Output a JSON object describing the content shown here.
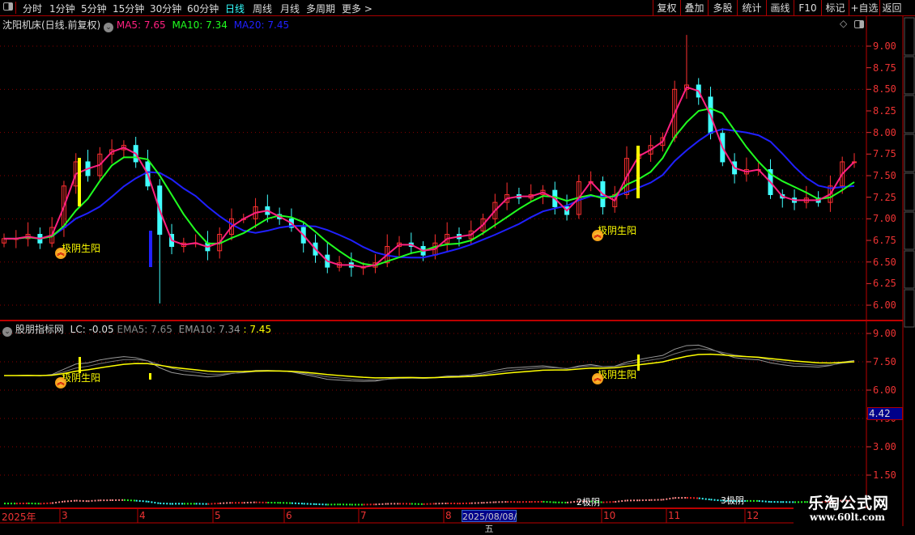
{
  "toolbar": {
    "tabs": [
      {
        "label": "分时"
      },
      {
        "label": "1分钟"
      },
      {
        "label": "5分钟"
      },
      {
        "label": "15分钟"
      },
      {
        "label": "30分钟"
      },
      {
        "label": "60分钟"
      },
      {
        "label": "日线",
        "active": true
      },
      {
        "label": "周线"
      },
      {
        "label": "月线"
      },
      {
        "label": "多周期"
      },
      {
        "label": "更多 >"
      }
    ],
    "right_buttons": [
      {
        "label": "复权"
      },
      {
        "label": "叠加"
      },
      {
        "label": "多股"
      },
      {
        "label": "统计"
      },
      {
        "label": "画线"
      },
      {
        "label": "F10"
      },
      {
        "label": "标记"
      },
      {
        "label": "+自选"
      },
      {
        "label": "返回"
      }
    ]
  },
  "main_chart": {
    "title": "沈阳机床(日线.前复权)",
    "ma5": "MA5: 7.65",
    "ma10": "MA10: 7.34",
    "ma20": "MA20: 7.45",
    "colors": {
      "ma5": "#ff2080",
      "ma10": "#20ff20",
      "ma20": "#2020ff",
      "up": "#ff3030",
      "down": "#40ffff",
      "axis": "#ee3333"
    },
    "y_ticks": [
      "9.00",
      "8.75",
      "8.50",
      "8.25",
      "8.00",
      "7.75",
      "7.50",
      "7.25",
      "7.00",
      "6.75",
      "6.50",
      "6.25",
      "6.00"
    ],
    "signals": [
      {
        "label": "极阴生阳"
      },
      {
        "label": "极阴生阳"
      }
    ]
  },
  "indicator": {
    "title": "股朋指标网",
    "lc": "LC: -0.05",
    "ema5": "EMA5: 7.65",
    "ema10": "EMA10: 7.34",
    "extra": ": 7.45",
    "y_ticks": [
      "9.00",
      "7.50",
      "6.00",
      "4.50",
      "3.00",
      "1.50"
    ],
    "cursor_value": "4.42",
    "signals": [
      {
        "label": "极阴生阳"
      },
      {
        "label": "极阴生阳"
      }
    ]
  },
  "strip": {
    "labels": [
      "2极阴",
      "3极阴"
    ]
  },
  "date_axis": {
    "labels": [
      "2025年",
      "3",
      "4",
      "5",
      "6",
      "7",
      "8",
      "10",
      "11",
      "12"
    ],
    "cursor_date": "2025/08/08/五"
  },
  "watermark": {
    "name": "乐淘公式网",
    "url": "www.60lt.com"
  },
  "chart_data": {
    "type": "candlestick",
    "ylim": [
      6.0,
      9.0
    ],
    "close": [
      6.77,
      6.77,
      6.82,
      6.72,
      6.9,
      7.38,
      7.66,
      7.5,
      7.75,
      7.8,
      7.85,
      7.66,
      7.38,
      6.82,
      6.68,
      6.72,
      6.72,
      6.63,
      6.82,
      7.0,
      7.0,
      7.14,
      7.05,
      7.0,
      6.9,
      6.72,
      6.58,
      6.44,
      6.49,
      6.44,
      6.44,
      6.49,
      6.68,
      6.72,
      6.68,
      6.58,
      6.72,
      6.82,
      6.77,
      6.86,
      7.0,
      7.19,
      7.28,
      7.24,
      7.28,
      7.33,
      7.14,
      7.05,
      7.43,
      7.43,
      7.14,
      7.28,
      7.7,
      7.75,
      7.85,
      7.94,
      8.5,
      8.55,
      8.41,
      7.99,
      7.66,
      7.52,
      7.57,
      7.57,
      7.28,
      7.24,
      7.19,
      7.24,
      7.19,
      7.38,
      7.66,
      7.66
    ],
    "extreme_high": 9.13,
    "extreme_low": 6.02
  }
}
